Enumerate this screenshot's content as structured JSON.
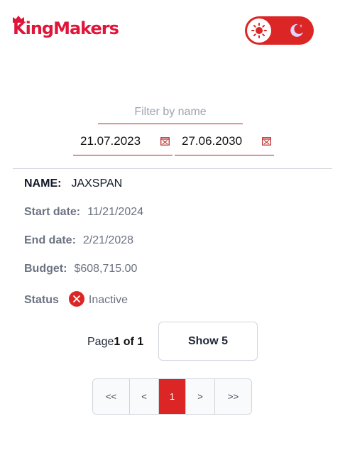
{
  "brand": {
    "name": "KingMakers",
    "color": "#e0153a"
  },
  "theme_toggle": {
    "state": "light",
    "sun_icon": "sun-icon",
    "moon_icon": "moon-icon",
    "color": "#dc2626"
  },
  "filters": {
    "name_placeholder": "Filter by name",
    "start_date": "21.07.2023",
    "end_date": "27.06.2030",
    "calendar_icon": "calendar-icon"
  },
  "record": {
    "name_label": "NAME:",
    "name_value": "JAXSPAN",
    "start_label": "Start date:",
    "start_value": "11/21/2024",
    "end_label": "End date:",
    "end_value": "2/21/2028",
    "budget_label": "Budget:",
    "budget_value": "$608,715.00",
    "status_label": "Status",
    "status_value": "Inactive",
    "status_icon": "x-circle-icon"
  },
  "pagination": {
    "page_prefix": "Page",
    "page_of": "1 of 1",
    "show_label": "Show 5",
    "first_label": "<<",
    "prev_label": "<",
    "current_page": "1",
    "next_label": ">",
    "last_label": ">>",
    "active_color": "#dc2626"
  }
}
